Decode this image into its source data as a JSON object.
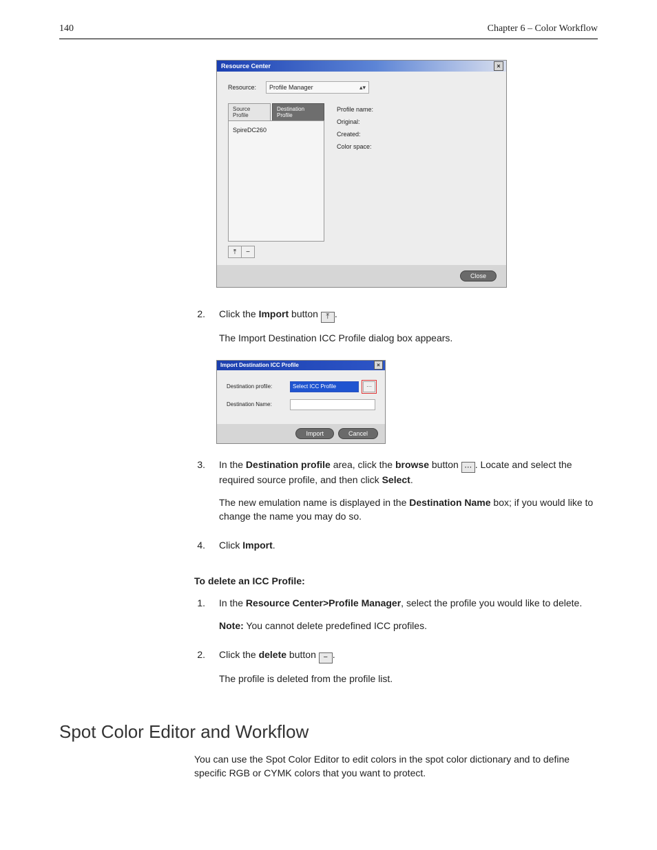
{
  "header": {
    "page_number": "140",
    "chapter": "Chapter 6 – Color Workflow"
  },
  "resource_center": {
    "title": "Resource Center",
    "resource_label": "Resource:",
    "resource_value": "Profile Manager",
    "tab_source": "Source Profile",
    "tab_destination": "Destination Profile",
    "list_item": "SpireDC260",
    "field_profile_name": "Profile name:",
    "field_original": "Original:",
    "field_created": "Created:",
    "field_color_space": "Color space:",
    "close_label": "Close"
  },
  "icc_dialog": {
    "title": "Import Destination ICC Profile",
    "dest_profile_label": "Destination profile:",
    "dest_profile_value": "Select ICC Profile",
    "dest_name_label": "Destination Name:",
    "import_label": "Import",
    "cancel_label": "Cancel"
  },
  "steps_a": {
    "n2": "2.",
    "s2a_pre": "Click the ",
    "s2a_bold": "Import",
    "s2a_post": " button ",
    "s2b": "The Import Destination ICC Profile dialog box appears.",
    "n3": "3.",
    "s3a_pre": "In the ",
    "s3a_b1": "Destination profile",
    "s3a_mid": " area, click the ",
    "s3a_b2": "browse",
    "s3a_post1": " button ",
    "s3a_post2": ". Locate and select the required source profile, and then click ",
    "s3a_b3": "Select",
    "s3b_pre": "The new emulation name is displayed in the ",
    "s3b_b": "Destination Name",
    "s3b_post": " box; if you would like to change the name you may do so.",
    "n4": "4.",
    "s4_pre": "Click ",
    "s4_b": "Import"
  },
  "delete_section": {
    "heading": "To delete an ICC Profile:",
    "n1": "1.",
    "s1_pre": "In the ",
    "s1_b": "Resource Center>Profile Manager",
    "s1_post": ", select the profile you would like to delete.",
    "note_b": "Note:",
    "note_post": "  You cannot delete predefined ICC profiles.",
    "n2": "2.",
    "s2_pre": "Click the ",
    "s2_b": "delete",
    "s2_post": " button ",
    "s2b": "The profile is deleted from the profile list."
  },
  "spot": {
    "heading": "Spot Color Editor and Workflow",
    "para": "You can use the Spot Color Editor to edit colors in the spot color dictionary and to define specific RGB or CYMK colors that you want to protect."
  }
}
